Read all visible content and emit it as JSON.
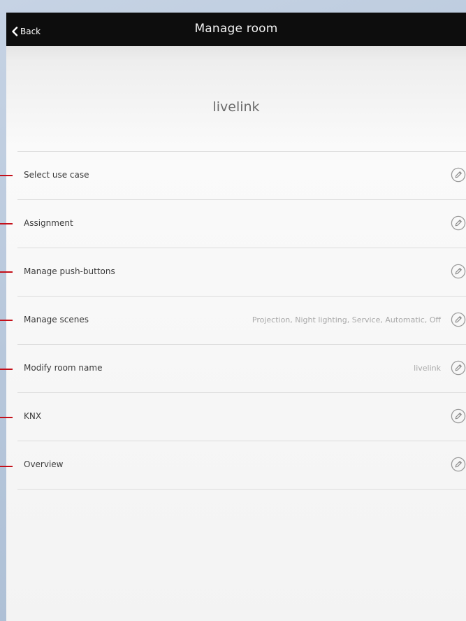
{
  "header": {
    "back_label": "Back",
    "title": "Manage room"
  },
  "room": {
    "name": "livelink"
  },
  "menu": {
    "items": [
      {
        "label": "Select use case",
        "value": ""
      },
      {
        "label": "Assignment",
        "value": ""
      },
      {
        "label": "Manage push-buttons",
        "value": ""
      },
      {
        "label": "Manage scenes",
        "value": "Projection, Night lighting, Service, Automatic, Off"
      },
      {
        "label": "Modify room name",
        "value": "livelink"
      },
      {
        "label": "KNX",
        "value": ""
      },
      {
        "label": "Overview",
        "value": ""
      }
    ]
  },
  "colors": {
    "topbar": "#0d0d0d",
    "callout_line": "#c4111b",
    "label_text": "#3a3a3a",
    "value_text": "#a9a9a9"
  },
  "icons": {
    "back": "chevron-left-icon",
    "edit": "pencil-circle-icon"
  }
}
